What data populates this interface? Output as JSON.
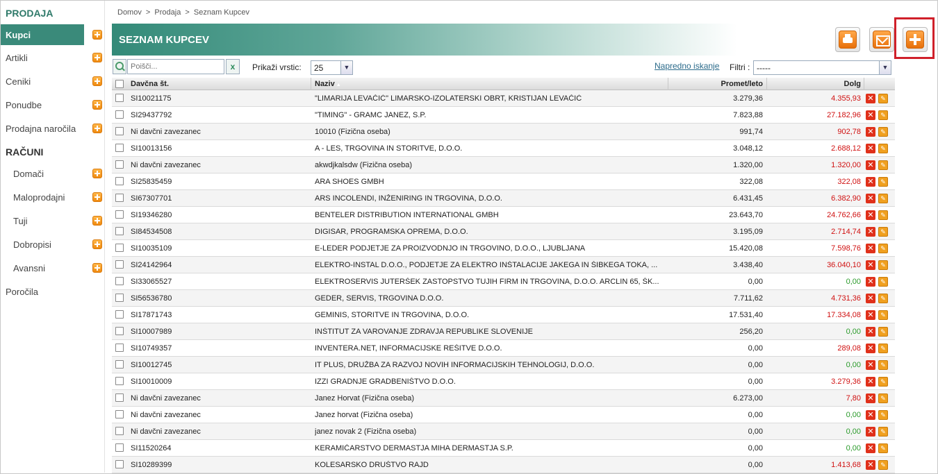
{
  "sidebar": {
    "section_prodaja": "PRODAJA",
    "section_racuni": "RAČUNI",
    "items": [
      {
        "label": "Kupci",
        "active": true
      },
      {
        "label": "Artikli"
      },
      {
        "label": "Ceniki"
      },
      {
        "label": "Ponudbe"
      },
      {
        "label": "Prodajna naročila"
      }
    ],
    "racuni_items": [
      {
        "label": "Domači"
      },
      {
        "label": "Maloprodajni"
      },
      {
        "label": "Tuji"
      },
      {
        "label": "Dobropisi"
      },
      {
        "label": "Avansni"
      }
    ],
    "porocila": "Poročila"
  },
  "breadcrumb": [
    "Domov",
    ">",
    "Prodaja",
    ">",
    "Seznam Kupcev"
  ],
  "page_title": "SEZNAM KUPCEV",
  "toolbar": {
    "print_icon": "printer-icon",
    "mail_icon": "envelope-icon",
    "add_icon": "plus-icon"
  },
  "filters": {
    "search_placeholder": "Poišči...",
    "clear_glyph": "x",
    "rows_label": "Prikaži vrstic:",
    "rows_value": "25",
    "advanced_search": "Napredno iskanje",
    "filter_label": "Filtri :",
    "filter_value": "-----"
  },
  "table": {
    "headers": {
      "tax": "Davčna št.",
      "name": "Naziv",
      "turnover": "Promet/leto",
      "debt": "Dolg"
    },
    "sort_indicator": "▲",
    "rows": [
      {
        "tax": "SI10021175",
        "name": "\"LIMARIJA LEVAČIĆ\" LIMARSKO-IZOLATERSKI OBRT, KRISTIJAN LEVAČIĆ",
        "turnover": "3.279,36",
        "debt": "4.355,93",
        "debt_status": "neg"
      },
      {
        "tax": "SI29437792",
        "name": "\"TIMING\" - GRAMC JANEZ, S.P.",
        "turnover": "7.823,88",
        "debt": "27.182,96",
        "debt_status": "neg"
      },
      {
        "tax": "Ni davčni zavezanec",
        "name": "10010 (Fizična oseba)",
        "turnover": "991,74",
        "debt": "902,78",
        "debt_status": "neg"
      },
      {
        "tax": "SI10013156",
        "name": "A - LES, TRGOVINA IN STORITVE, D.O.O.",
        "turnover": "3.048,12",
        "debt": "2.688,12",
        "debt_status": "neg"
      },
      {
        "tax": "Ni davčni zavezanec",
        "name": "akwdjkalsdw (Fizična oseba)",
        "turnover": "1.320,00",
        "debt": "1.320,00",
        "debt_status": "neg"
      },
      {
        "tax": "SI25835459",
        "name": "ARA SHOES GMBH",
        "turnover": "322,08",
        "debt": "322,08",
        "debt_status": "neg"
      },
      {
        "tax": "SI67307701",
        "name": "ARS INCOLENDI, INŽENIRING IN TRGOVINA, D.O.O.",
        "turnover": "6.431,45",
        "debt": "6.382,90",
        "debt_status": "neg"
      },
      {
        "tax": "SI19346280",
        "name": "BENTELER DISTRIBUTION INTERNATIONAL GMBH",
        "turnover": "23.643,70",
        "debt": "24.762,66",
        "debt_status": "neg"
      },
      {
        "tax": "SI84534508",
        "name": "DIGISAR, PROGRAMSKA OPREMA, D.O.O.",
        "turnover": "3.195,09",
        "debt": "2.714,74",
        "debt_status": "neg"
      },
      {
        "tax": "SI10035109",
        "name": "E-LEDER PODJETJE ZA PROIZVODNJO IN TRGOVINO, D.O.O., LJUBLJANA",
        "turnover": "15.420,08",
        "debt": "7.598,76",
        "debt_status": "neg"
      },
      {
        "tax": "SI24142964",
        "name": "ELEKTRO-INSTAL D.O.O., PODJETJE ZA ELEKTRO INŠTALACIJE JAKEGA IN ŠIBKEGA TOKA, ...",
        "turnover": "3.438,40",
        "debt": "36.040,10",
        "debt_status": "neg"
      },
      {
        "tax": "SI33065527",
        "name": "ELEKTROSERVIS JUTERŠEK ZASTOPSTVO TUJIH FIRM IN TRGOVINA, D.O.O. ARCLIN 65, ŠK...",
        "turnover": "0,00",
        "debt": "0,00",
        "debt_status": "zero"
      },
      {
        "tax": "SI56536780",
        "name": "GEDER, SERVIS, TRGOVINA D.O.O.",
        "turnover": "7.711,62",
        "debt": "4.731,36",
        "debt_status": "neg"
      },
      {
        "tax": "SI17871743",
        "name": "GEMINIS, STORITVE IN TRGOVINA, D.O.O.",
        "turnover": "17.531,40",
        "debt": "17.334,08",
        "debt_status": "neg"
      },
      {
        "tax": "SI10007989",
        "name": "INŠTITUT ZA VAROVANJE ZDRAVJA REPUBLIKE SLOVENIJE",
        "turnover": "256,20",
        "debt": "0,00",
        "debt_status": "zero"
      },
      {
        "tax": "SI10749357",
        "name": "INVENTERA.NET, INFORMACIJSKE REŠITVE D.O.O.",
        "turnover": "0,00",
        "debt": "289,08",
        "debt_status": "neg"
      },
      {
        "tax": "SI10012745",
        "name": "IT PLUS, DRUŽBA ZA RAZVOJ NOVIH INFORMACIJSKIH TEHNOLOGIJ, D.O.O.",
        "turnover": "0,00",
        "debt": "0,00",
        "debt_status": "zero"
      },
      {
        "tax": "SI10010009",
        "name": "IZZI GRADNJE GRADBENIŠTVO D.O.O.",
        "turnover": "0,00",
        "debt": "3.279,36",
        "debt_status": "neg"
      },
      {
        "tax": "Ni davčni zavezanec",
        "name": "Janez Horvat (Fizična oseba)",
        "turnover": "6.273,00",
        "debt": "7,80",
        "debt_status": "neg"
      },
      {
        "tax": "Ni davčni zavezanec",
        "name": "Janez horvat (Fizična oseba)",
        "turnover": "0,00",
        "debt": "0,00",
        "debt_status": "zero"
      },
      {
        "tax": "Ni davčni zavezanec",
        "name": "janez novak 2 (Fizična oseba)",
        "turnover": "0,00",
        "debt": "0,00",
        "debt_status": "zero"
      },
      {
        "tax": "SI11520264",
        "name": "KERAMIČARSTVO DERMASTJA MIHA DERMASTJA S.P.",
        "turnover": "0,00",
        "debt": "0,00",
        "debt_status": "zero"
      },
      {
        "tax": "SI10289399",
        "name": "KOLESARSKO DRUŠTVO RAJD",
        "turnover": "0,00",
        "debt": "1.413,68",
        "debt_status": "neg"
      }
    ]
  },
  "colors": {
    "accent": "#3a8a7a",
    "negative": "#d01010",
    "zero": "#2a9a2a",
    "highlight": "#d0202a"
  }
}
